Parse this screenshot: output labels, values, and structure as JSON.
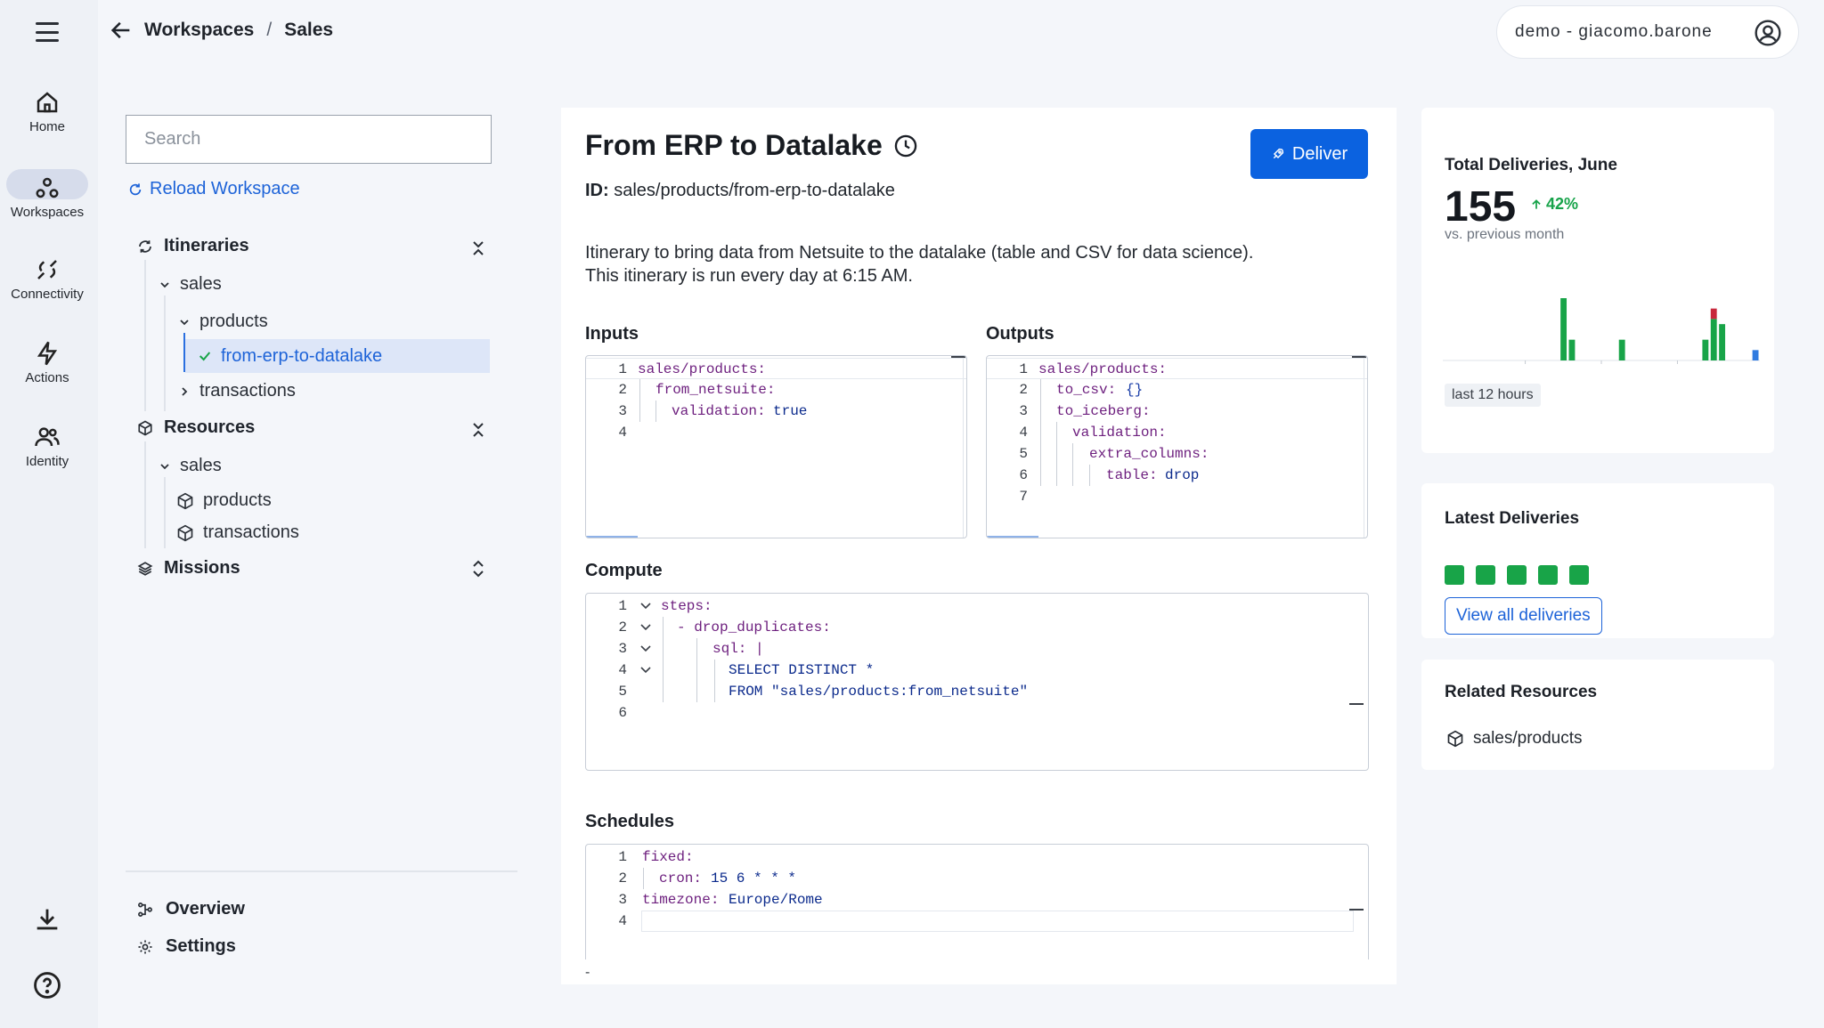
{
  "topbar": {
    "breadcrumb": [
      "Workspaces",
      "/",
      "Sales"
    ],
    "user": "demo - giacomo.barone"
  },
  "rail": {
    "items": [
      {
        "label": "Home",
        "icon": "home-icon"
      },
      {
        "label": "Workspaces",
        "icon": "workspaces-icon"
      },
      {
        "label": "Connectivity",
        "icon": "connectivity-icon"
      },
      {
        "label": "Actions",
        "icon": "bolt-icon"
      },
      {
        "label": "Identity",
        "icon": "users-icon"
      }
    ]
  },
  "sidebar": {
    "search_placeholder": "Search",
    "reload_label": "Reload Workspace",
    "itineraries": {
      "title": "Itineraries",
      "sales": "sales",
      "products": "products",
      "selected": "from-erp-to-datalake",
      "transactions": "transactions"
    },
    "resources": {
      "title": "Resources",
      "sales": "sales",
      "products": "products",
      "transactions": "transactions"
    },
    "missions": {
      "title": "Missions"
    },
    "overview": "Overview",
    "settings": "Settings"
  },
  "main": {
    "title": "From ERP to Datalake",
    "deliver_label": "Deliver",
    "id_label": "ID:",
    "id_value": "sales/products/from-erp-to-datalake",
    "description_1": "Itinerary to bring data from Netsuite to the datalake (table and CSV for data science).",
    "description_2": "This itinerary is run every day at 6:15 AM.",
    "inputs_title": "Inputs",
    "outputs_title": "Outputs",
    "compute_title": "Compute",
    "schedules_title": "Schedules",
    "inputs_code": {
      "l1": "sales/products:",
      "l2k": "from_netsuite:",
      "l3k": "validation:",
      "l3v": "true"
    },
    "outputs_code": {
      "l1": "sales/products:",
      "l2k": "to_csv:",
      "l2v": "{}",
      "l3k": "to_iceberg:",
      "l4k": "validation:",
      "l5k": "extra_columns:",
      "l6k": "table:",
      "l6v": "drop"
    },
    "compute_code": {
      "l1": "steps:",
      "l2": "- drop_duplicates:",
      "l3": "sql: |",
      "l4": "SELECT DISTINCT *",
      "l5": "FROM \"sales/products:from_netsuite\""
    },
    "schedules_code": {
      "l1": "fixed:",
      "l2k": "cron:",
      "l2v": "15 6 * * *",
      "l3k": "timezone:",
      "l3v": "Europe/Rome"
    },
    "bottom_mark": "-"
  },
  "stats": {
    "title": "Total Deliveries, June",
    "value": "155",
    "delta": "42%",
    "compare": "vs. previous month",
    "range_chip": "last 12 hours"
  },
  "latest": {
    "title": "Latest Deliveries",
    "count_ok": 5,
    "view_all": "View all deliveries"
  },
  "related": {
    "title": "Related Resources",
    "item": "sales/products"
  },
  "colors": {
    "accent": "#0b62e0",
    "success": "#18a448",
    "error": "#c8283c",
    "info": "#2f7be0"
  },
  "chart_data": {
    "type": "bar",
    "title": "",
    "series": [
      {
        "values": [
          0,
          0,
          0,
          0,
          0,
          0,
          0,
          0,
          0,
          0,
          0,
          0,
          0,
          0,
          6,
          2,
          0,
          0,
          0,
          0,
          0,
          2,
          0,
          0,
          0,
          0,
          0,
          0,
          0,
          0,
          0,
          2,
          4,
          3.5,
          0,
          0,
          0,
          0
        ]
      },
      {
        "values": [
          0,
          0,
          0,
          0,
          0,
          0,
          0,
          0,
          0,
          0,
          0,
          0,
          0,
          0,
          0,
          0,
          0,
          0,
          0,
          0,
          0,
          0,
          0,
          0,
          0,
          0,
          0,
          0,
          0,
          0,
          0,
          0,
          1,
          0,
          0,
          0,
          0,
          0
        ]
      },
      {
        "values": [
          0,
          0,
          0,
          0,
          0,
          0,
          0,
          0,
          0,
          0,
          0,
          0,
          0,
          0,
          0,
          0,
          0,
          0,
          0,
          0,
          0,
          0,
          0,
          0,
          0,
          0,
          0,
          0,
          0,
          0,
          0,
          0,
          0,
          0,
          0,
          0,
          0,
          1
        ]
      }
    ]
  }
}
